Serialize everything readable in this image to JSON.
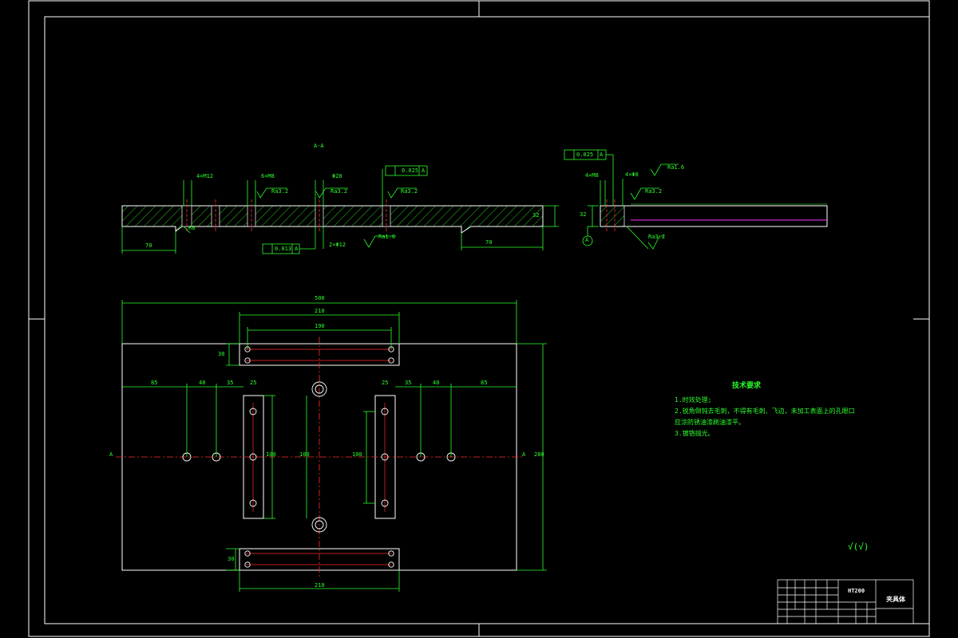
{
  "colors": {
    "background": "#000000",
    "frame": "#ffffff",
    "dimension": "#2bff2b",
    "centerline": "#ff2b2b",
    "hatch": "#2bff2b",
    "accent_line": "#ff33ff"
  },
  "section_view": {
    "label": "A-A",
    "callouts": {
      "holes_4x": "4×M12",
      "holes_6x": "6×M8",
      "dia": "Φ20",
      "parallel_tol": "0.025",
      "datum_a": "A",
      "perp_tol": "0.013",
      "perp_datum": "A",
      "ra_1": "Ra3.2",
      "ra_2": "Ra3.2",
      "ra_3": "Ra3.2",
      "ra_4": "Ra1.6",
      "hole_2x": "2×Φ12",
      "left_len": "70",
      "right_len": "70",
      "thickness": "32",
      "rad": "R8"
    }
  },
  "side_view": {
    "parallel_tol": "0.025",
    "datum": "A",
    "holes": "4×M8",
    "holes2": "4×Φ8",
    "ra_1": "Ra1.6",
    "ra_2": "Ra3.2",
    "ra_3": "Ra3.2",
    "height": "32"
  },
  "plan_view": {
    "overall_width": "500",
    "top_slot_len": "210",
    "top_slot_inner": "190",
    "bottom_slot_len": "210",
    "slot_width": "30",
    "dims_left": [
      "85",
      "40",
      "35",
      "25"
    ],
    "dims_right": [
      "25",
      "35",
      "40",
      "85"
    ],
    "overall_height": "280",
    "side_dim_left": "100",
    "side_dim_mid": "100",
    "side_dim_right": "100",
    "section_mark": "A"
  },
  "tech_notes": {
    "title": "技术要求",
    "lines": [
      "1.时效处理;",
      "2.锐角倒钝去毛刺，不得有毛刺、飞边，未加工表面上的孔眼口",
      "应涂防锈油漆刷油漆平。",
      "3.镀铬抛光。"
    ]
  },
  "roughness_symbol": "√(√)",
  "title_block": {
    "material": "HT200",
    "part_name": "夹具体"
  }
}
